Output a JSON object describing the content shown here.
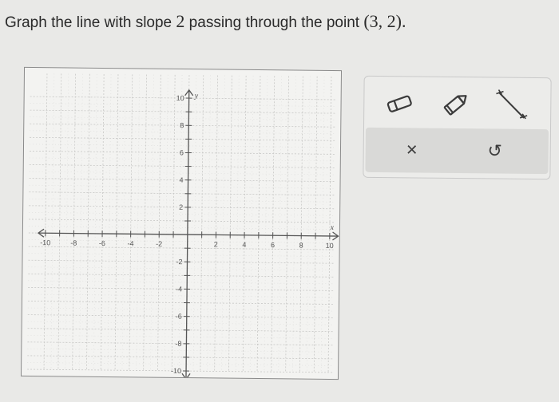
{
  "question": {
    "text_before": "Graph the line with slope ",
    "slope": "2",
    "text_middle": " passing through the point ",
    "point": "(3, 2)",
    "text_end": "."
  },
  "graph": {
    "x_axis_label": "x",
    "y_axis_label": "y",
    "x_min": -10,
    "x_max": 10,
    "y_min": -10,
    "y_max": 10,
    "tick_labels": [
      "-10",
      "-8",
      "-6",
      "-4",
      "-2",
      "2",
      "4",
      "6",
      "8",
      "10"
    ],
    "grid": true
  },
  "tools": {
    "eraser_icon": "eraser-icon",
    "pencil_icon": "pencil-icon",
    "line_tool_icon": "line-tool-icon"
  },
  "actions": {
    "clear_glyph": "×",
    "undo_glyph": "↺"
  }
}
